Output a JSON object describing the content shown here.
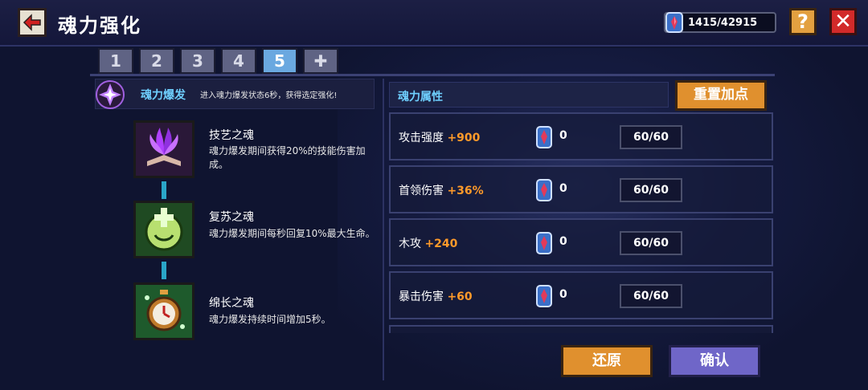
{
  "header": {
    "title": "魂力强化",
    "currency_value": "1415/42915",
    "help_label": "?",
    "close_label": "✕"
  },
  "tabs": [
    {
      "label": "1"
    },
    {
      "label": "2"
    },
    {
      "label": "3"
    },
    {
      "label": "4"
    },
    {
      "label": "5",
      "active": true
    },
    {
      "label": "✚"
    }
  ],
  "burst": {
    "name": "魂力爆发",
    "description": "进入魂力爆发状态6秒，获得选定强化!"
  },
  "skills": [
    {
      "name": "技艺之魂",
      "description": "魂力爆发期间获得20%的技能伤害加成。",
      "icon": "purple-flame-book-icon"
    },
    {
      "name": "复苏之魂",
      "description": "魂力爆发期间每秒回复10%最大生命。",
      "icon": "green-heal-orb-icon"
    },
    {
      "name": "绵长之魂",
      "description": "魂力爆发持续时间增加5秒。",
      "icon": "stopwatch-icon"
    }
  ],
  "attributes": {
    "header": "魂力属性",
    "reset_label": "重置加点",
    "rows": [
      {
        "label": "攻击强度",
        "value": "+900",
        "count": "0",
        "level": "60/60"
      },
      {
        "label": "首领伤害",
        "value": "+36%",
        "count": "0",
        "level": "60/60"
      },
      {
        "label": "木攻",
        "value": "+240",
        "count": "0",
        "level": "60/60"
      },
      {
        "label": "暴击伤害",
        "value": "+60",
        "count": "0",
        "level": "60/60"
      }
    ]
  },
  "footer": {
    "restore_label": "还原",
    "confirm_label": "确认"
  },
  "colors": {
    "accent_orange": "#e0902e",
    "accent_purple": "#6f66c8",
    "value_orange": "#ff9a2a",
    "title_cyan": "#6fd0ff",
    "active_tab": "#6aa8e0"
  }
}
